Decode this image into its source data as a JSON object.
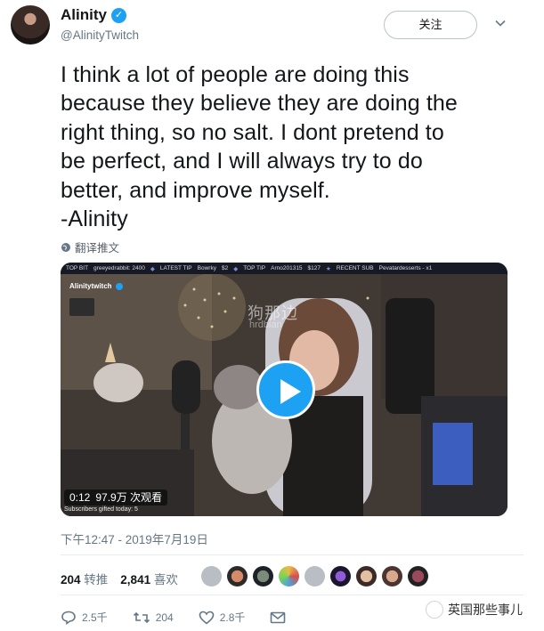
{
  "header": {
    "name": "Alinity",
    "handle": "@AlinityTwitch",
    "follow_label": "关注"
  },
  "tweet": {
    "text": "I think a lot of people are doing this\nbecause they believe they are doing the\nright thing, so no salt. I dont pretend to\nbe perfect, and I will always try to do\nbetter, and improve myself.\n-Alinity",
    "translate_label": "翻译推文",
    "timestamp": "下午12:47 - 2019年7月19日"
  },
  "video": {
    "ticker": [
      "TOP BIT",
      "greeyedrabbit: 2400",
      "LATEST TIP",
      "Bowrky",
      "$2",
      "TOP TIP",
      "Arno201315",
      "$127",
      "RECENT SUB",
      "Pevatardesserts - x1"
    ],
    "channel": "Alinitytwitch",
    "watermark": "狗那边",
    "watermark_sub": "hrdbian",
    "duration": "0:12",
    "views": "97.9万 次观看",
    "caption": "Subscribers gifted today: 5"
  },
  "stats": {
    "retweets": "204",
    "retweets_label": "转推",
    "likes": "2,841",
    "likes_label": "喜欢"
  },
  "actions": {
    "replies": "2.5千",
    "retweets": "204",
    "likes": "2.8千"
  },
  "brand": {
    "label": "英国那些事儿"
  },
  "colors": {
    "accent": "#1da1f2",
    "secondary_text": "#657786"
  }
}
